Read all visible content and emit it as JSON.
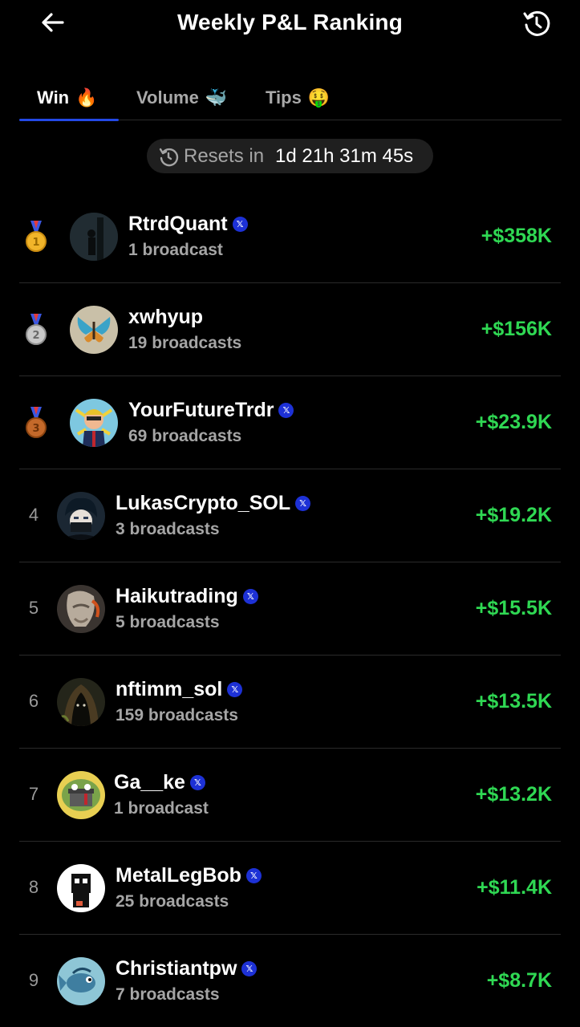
{
  "header": {
    "title": "Weekly P&L Ranking",
    "back_icon": "arrow-left-icon",
    "history_icon": "history-icon"
  },
  "tabs": [
    {
      "label": "Win",
      "emoji": "🔥",
      "active": true
    },
    {
      "label": "Volume",
      "emoji": "🐳",
      "active": false
    },
    {
      "label": "Tips",
      "emoji": "🤑",
      "active": false
    }
  ],
  "reset": {
    "label": "Resets in",
    "countdown": "1d 21h 31m 45s",
    "icon": "timer-icon"
  },
  "colors": {
    "accent": "#2349e6",
    "positive": "#2fd853",
    "muted": "#a5a5a5",
    "background": "#000000",
    "verified": "#1d31d6"
  },
  "rankings": [
    {
      "rank": "1",
      "medal": "gold",
      "name": "RtrdQuant",
      "verified": true,
      "broadcasts": "1 broadcast",
      "pnl": "+$358K"
    },
    {
      "rank": "2",
      "medal": "silver",
      "name": "xwhyup",
      "verified": false,
      "broadcasts": "19 broadcasts",
      "pnl": "+$156K"
    },
    {
      "rank": "3",
      "medal": "bronze",
      "name": "YourFutureTrdr",
      "verified": true,
      "broadcasts": "69 broadcasts",
      "pnl": "+$23.9K"
    },
    {
      "rank": "4",
      "medal": null,
      "name": "LukasCrypto_SOL",
      "verified": true,
      "broadcasts": "3 broadcasts",
      "pnl": "+$19.2K"
    },
    {
      "rank": "5",
      "medal": null,
      "name": "Haikutrading",
      "verified": true,
      "broadcasts": "5 broadcasts",
      "pnl": "+$15.5K"
    },
    {
      "rank": "6",
      "medal": null,
      "name": "nftimm_sol",
      "verified": true,
      "broadcasts": "159 broadcasts",
      "pnl": "+$13.5K"
    },
    {
      "rank": "7",
      "medal": null,
      "name": "Ga__ke",
      "verified": true,
      "broadcasts": "1 broadcast",
      "pnl": "+$13.2K"
    },
    {
      "rank": "8",
      "medal": null,
      "name": "MetalLegBob",
      "verified": true,
      "broadcasts": "25 broadcasts",
      "pnl": "+$11.4K"
    },
    {
      "rank": "9",
      "medal": null,
      "name": "Christiantpw",
      "verified": true,
      "broadcasts": "7 broadcasts",
      "pnl": "+$8.7K"
    }
  ]
}
